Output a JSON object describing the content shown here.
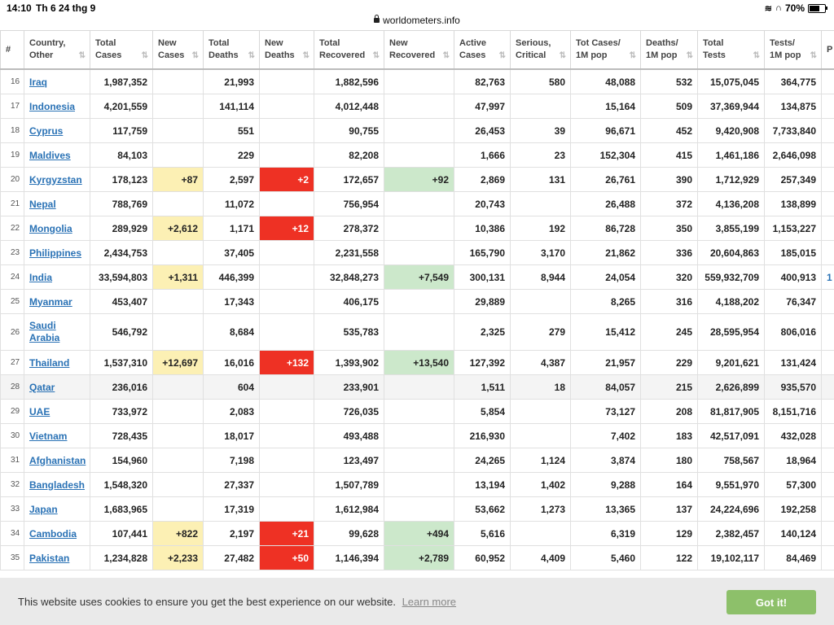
{
  "status": {
    "time": "14:10",
    "date": "Th 6 24 thg 9",
    "url": "worldometers.info",
    "battery": "70%"
  },
  "headers": [
    {
      "l1": "",
      "l2": "#",
      "sort": false
    },
    {
      "l1": "Country,",
      "l2": "Other",
      "sort": true
    },
    {
      "l1": "Total",
      "l2": "Cases",
      "sort": true
    },
    {
      "l1": "New",
      "l2": "Cases",
      "sort": true
    },
    {
      "l1": "Total",
      "l2": "Deaths",
      "sort": true
    },
    {
      "l1": "New",
      "l2": "Deaths",
      "sort": true
    },
    {
      "l1": "Total",
      "l2": "Recovered",
      "sort": true
    },
    {
      "l1": "New",
      "l2": "Recovered",
      "sort": true
    },
    {
      "l1": "Active",
      "l2": "Cases",
      "sort": true
    },
    {
      "l1": "Serious,",
      "l2": "Critical",
      "sort": true
    },
    {
      "l1": "Tot Cases/",
      "l2": "1M pop",
      "sort": true
    },
    {
      "l1": "Deaths/",
      "l2": "1M pop",
      "sort": true
    },
    {
      "l1": "Total",
      "l2": "Tests",
      "sort": true
    },
    {
      "l1": "Tests/",
      "l2": "1M pop",
      "sort": true
    },
    {
      "l1": "",
      "l2": "P",
      "sort": false
    }
  ],
  "rows": [
    {
      "idx": "16",
      "country": "Iraq",
      "total_cases": "1,987,352",
      "new_cases": "",
      "total_deaths": "21,993",
      "new_deaths": "",
      "total_recovered": "1,882,596",
      "new_recovered": "",
      "active": "82,763",
      "serious": "580",
      "cases_1m": "48,088",
      "deaths_1m": "532",
      "total_tests": "15,075,045",
      "tests_1m": "364,775",
      "extra": ""
    },
    {
      "idx": "17",
      "country": "Indonesia",
      "total_cases": "4,201,559",
      "new_cases": "",
      "total_deaths": "141,114",
      "new_deaths": "",
      "total_recovered": "4,012,448",
      "new_recovered": "",
      "active": "47,997",
      "serious": "",
      "cases_1m": "15,164",
      "deaths_1m": "509",
      "total_tests": "37,369,944",
      "tests_1m": "134,875",
      "extra": ""
    },
    {
      "idx": "18",
      "country": "Cyprus",
      "total_cases": "117,759",
      "new_cases": "",
      "total_deaths": "551",
      "new_deaths": "",
      "total_recovered": "90,755",
      "new_recovered": "",
      "active": "26,453",
      "serious": "39",
      "cases_1m": "96,671",
      "deaths_1m": "452",
      "total_tests": "9,420,908",
      "tests_1m": "7,733,840",
      "extra": ""
    },
    {
      "idx": "19",
      "country": "Maldives",
      "total_cases": "84,103",
      "new_cases": "",
      "total_deaths": "229",
      "new_deaths": "",
      "total_recovered": "82,208",
      "new_recovered": "",
      "active": "1,666",
      "serious": "23",
      "cases_1m": "152,304",
      "deaths_1m": "415",
      "total_tests": "1,461,186",
      "tests_1m": "2,646,098",
      "extra": ""
    },
    {
      "idx": "20",
      "country": "Kyrgyzstan",
      "total_cases": "178,123",
      "new_cases": "+87",
      "total_deaths": "2,597",
      "new_deaths": "+2",
      "total_recovered": "172,657",
      "new_recovered": "+92",
      "active": "2,869",
      "serious": "131",
      "cases_1m": "26,761",
      "deaths_1m": "390",
      "total_tests": "1,712,929",
      "tests_1m": "257,349",
      "extra": ""
    },
    {
      "idx": "21",
      "country": "Nepal",
      "total_cases": "788,769",
      "new_cases": "",
      "total_deaths": "11,072",
      "new_deaths": "",
      "total_recovered": "756,954",
      "new_recovered": "",
      "active": "20,743",
      "serious": "",
      "cases_1m": "26,488",
      "deaths_1m": "372",
      "total_tests": "4,136,208",
      "tests_1m": "138,899",
      "extra": ""
    },
    {
      "idx": "22",
      "country": "Mongolia",
      "total_cases": "289,929",
      "new_cases": "+2,612",
      "total_deaths": "1,171",
      "new_deaths": "+12",
      "total_recovered": "278,372",
      "new_recovered": "",
      "active": "10,386",
      "serious": "192",
      "cases_1m": "86,728",
      "deaths_1m": "350",
      "total_tests": "3,855,199",
      "tests_1m": "1,153,227",
      "extra": ""
    },
    {
      "idx": "23",
      "country": "Philippines",
      "total_cases": "2,434,753",
      "new_cases": "",
      "total_deaths": "37,405",
      "new_deaths": "",
      "total_recovered": "2,231,558",
      "new_recovered": "",
      "active": "165,790",
      "serious": "3,170",
      "cases_1m": "21,862",
      "deaths_1m": "336",
      "total_tests": "20,604,863",
      "tests_1m": "185,015",
      "extra": ""
    },
    {
      "idx": "24",
      "country": "India",
      "total_cases": "33,594,803",
      "new_cases": "+1,311",
      "total_deaths": "446,399",
      "new_deaths": "",
      "total_recovered": "32,848,273",
      "new_recovered": "+7,549",
      "active": "300,131",
      "serious": "8,944",
      "cases_1m": "24,054",
      "deaths_1m": "320",
      "total_tests": "559,932,709",
      "tests_1m": "400,913",
      "extra": "1"
    },
    {
      "idx": "25",
      "country": "Myanmar",
      "total_cases": "453,407",
      "new_cases": "",
      "total_deaths": "17,343",
      "new_deaths": "",
      "total_recovered": "406,175",
      "new_recovered": "",
      "active": "29,889",
      "serious": "",
      "cases_1m": "8,265",
      "deaths_1m": "316",
      "total_tests": "4,188,202",
      "tests_1m": "76,347",
      "extra": ""
    },
    {
      "idx": "26",
      "country": "Saudi Arabia",
      "total_cases": "546,792",
      "new_cases": "",
      "total_deaths": "8,684",
      "new_deaths": "",
      "total_recovered": "535,783",
      "new_recovered": "",
      "active": "2,325",
      "serious": "279",
      "cases_1m": "15,412",
      "deaths_1m": "245",
      "total_tests": "28,595,954",
      "tests_1m": "806,016",
      "extra": ""
    },
    {
      "idx": "27",
      "country": "Thailand",
      "total_cases": "1,537,310",
      "new_cases": "+12,697",
      "total_deaths": "16,016",
      "new_deaths": "+132",
      "total_recovered": "1,393,902",
      "new_recovered": "+13,540",
      "active": "127,392",
      "serious": "4,387",
      "cases_1m": "21,957",
      "deaths_1m": "229",
      "total_tests": "9,201,621",
      "tests_1m": "131,424",
      "extra": ""
    },
    {
      "idx": "28",
      "country": "Qatar",
      "total_cases": "236,016",
      "new_cases": "",
      "total_deaths": "604",
      "new_deaths": "",
      "total_recovered": "233,901",
      "new_recovered": "",
      "active": "1,511",
      "serious": "18",
      "cases_1m": "84,057",
      "deaths_1m": "215",
      "total_tests": "2,626,899",
      "tests_1m": "935,570",
      "extra": ""
    },
    {
      "idx": "29",
      "country": "UAE",
      "total_cases": "733,972",
      "new_cases": "",
      "total_deaths": "2,083",
      "new_deaths": "",
      "total_recovered": "726,035",
      "new_recovered": "",
      "active": "5,854",
      "serious": "",
      "cases_1m": "73,127",
      "deaths_1m": "208",
      "total_tests": "81,817,905",
      "tests_1m": "8,151,716",
      "extra": ""
    },
    {
      "idx": "30",
      "country": "Vietnam",
      "total_cases": "728,435",
      "new_cases": "",
      "total_deaths": "18,017",
      "new_deaths": "",
      "total_recovered": "493,488",
      "new_recovered": "",
      "active": "216,930",
      "serious": "",
      "cases_1m": "7,402",
      "deaths_1m": "183",
      "total_tests": "42,517,091",
      "tests_1m": "432,028",
      "extra": ""
    },
    {
      "idx": "31",
      "country": "Afghanistan",
      "total_cases": "154,960",
      "new_cases": "",
      "total_deaths": "7,198",
      "new_deaths": "",
      "total_recovered": "123,497",
      "new_recovered": "",
      "active": "24,265",
      "serious": "1,124",
      "cases_1m": "3,874",
      "deaths_1m": "180",
      "total_tests": "758,567",
      "tests_1m": "18,964",
      "extra": ""
    },
    {
      "idx": "32",
      "country": "Bangladesh",
      "total_cases": "1,548,320",
      "new_cases": "",
      "total_deaths": "27,337",
      "new_deaths": "",
      "total_recovered": "1,507,789",
      "new_recovered": "",
      "active": "13,194",
      "serious": "1,402",
      "cases_1m": "9,288",
      "deaths_1m": "164",
      "total_tests": "9,551,970",
      "tests_1m": "57,300",
      "extra": ""
    },
    {
      "idx": "33",
      "country": "Japan",
      "total_cases": "1,683,965",
      "new_cases": "",
      "total_deaths": "17,319",
      "new_deaths": "",
      "total_recovered": "1,612,984",
      "new_recovered": "",
      "active": "53,662",
      "serious": "1,273",
      "cases_1m": "13,365",
      "deaths_1m": "137",
      "total_tests": "24,224,696",
      "tests_1m": "192,258",
      "extra": ""
    },
    {
      "idx": "34",
      "country": "Cambodia",
      "total_cases": "107,441",
      "new_cases": "+822",
      "total_deaths": "2,197",
      "new_deaths": "+21",
      "total_recovered": "99,628",
      "new_recovered": "+494",
      "active": "5,616",
      "serious": "",
      "cases_1m": "6,319",
      "deaths_1m": "129",
      "total_tests": "2,382,457",
      "tests_1m": "140,124",
      "extra": ""
    },
    {
      "idx": "35",
      "country": "Pakistan",
      "total_cases": "1,234,828",
      "new_cases": "+2,233",
      "total_deaths": "27,482",
      "new_deaths": "+50",
      "total_recovered": "1,146,394",
      "new_recovered": "+2,789",
      "active": "60,952",
      "serious": "4,409",
      "cases_1m": "5,460",
      "deaths_1m": "122",
      "total_tests": "19,102,117",
      "tests_1m": "84,469",
      "extra": ""
    }
  ],
  "cookie": {
    "text": "This website uses cookies to ensure you get the best experience on our website.",
    "link": "Learn more",
    "button": "Got it!"
  },
  "colors": {
    "new_cases_bg": "#fcf0b4",
    "new_deaths_bg": "#ee3124",
    "new_recovered_bg": "#cce8cb",
    "link": "#2a72b5",
    "cookie_button": "#8dc06a"
  }
}
